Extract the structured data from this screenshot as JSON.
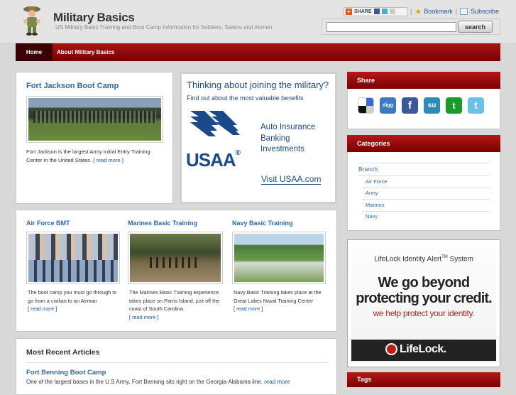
{
  "header": {
    "title": "Military Basics",
    "tagline": "US Military Basic Training and Boot Camp Information for Soldiers, Sailors and Airmen",
    "share_label": "SHARE",
    "bookmark_label": "Bookmark",
    "subscribe_label": "Subscribe",
    "search_placeholder": "",
    "search_button": "search"
  },
  "nav": {
    "items": [
      {
        "label": "Home"
      },
      {
        "label": "About Military Basics"
      }
    ]
  },
  "featured": {
    "title": "Fort Jackson Boot Camp",
    "text": "Fort Jackson is the largest Army Initial Entry Training Center in the United States. [",
    "read_more": "read more",
    "close": "]"
  },
  "usaa_ad": {
    "headline": "Thinking about joining the military?",
    "subline": "Find out about the most valuable benefits",
    "brand": "USAA",
    "reg": "®",
    "services": [
      "Auto Insurance",
      "Banking",
      "Investments"
    ],
    "visit": "Visit USAA.com"
  },
  "trainings": [
    {
      "title": "Air Force BMT",
      "text": "The boot camp you must go through to go from a civilian to an Airman",
      "read_more": "read more"
    },
    {
      "title": "Marines Basic Training",
      "text": "The Marines Basic Training experience takes place on Parris Island, just off the coast of South Carolina.",
      "read_more": "read more"
    },
    {
      "title": "Navy Basic Training",
      "text": "Navy Basic Training takes place at the Great Lakes Naval Training Center",
      "read_more": "read more"
    }
  ],
  "recent": {
    "heading": "Most Recent Articles",
    "article_title": "Fort Benning Boot Camp",
    "article_text": "One of the largest bases in the U.S Army, Fort Benning sits right on the Georgia-Alabama line.",
    "read_more": "read more"
  },
  "sidebar": {
    "share_heading": "Share",
    "social": [
      {
        "name": "delicious",
        "glyph": "",
        "color": "#3a6ad0"
      },
      {
        "name": "digg",
        "glyph": "digg",
        "color": "#2a6ab0"
      },
      {
        "name": "facebook",
        "glyph": "f",
        "color": "#3b5998"
      },
      {
        "name": "stumbleupon",
        "glyph": "su",
        "color": "#2e8ab8"
      },
      {
        "name": "technorati",
        "glyph": "t",
        "color": "#1a9a2a"
      },
      {
        "name": "twitter",
        "glyph": "t",
        "color": "#4aaad8"
      }
    ],
    "categories_heading": "Categories",
    "category_parent": "Branch",
    "categories": [
      "Air Force",
      "Army",
      "Marines",
      "Navy"
    ],
    "tags_heading": "Tags"
  },
  "lifelock_ad": {
    "system": "LifeLock Identity Alert",
    "tm": "TM",
    "system_suffix": " System",
    "line1": "We go beyond",
    "line2": "protecting your credit.",
    "line3": "we help protect your identity.",
    "brand": "LifeLock."
  },
  "colors": {
    "accent_red": "#9a0a0a",
    "link_blue": "#2a6ab0"
  }
}
